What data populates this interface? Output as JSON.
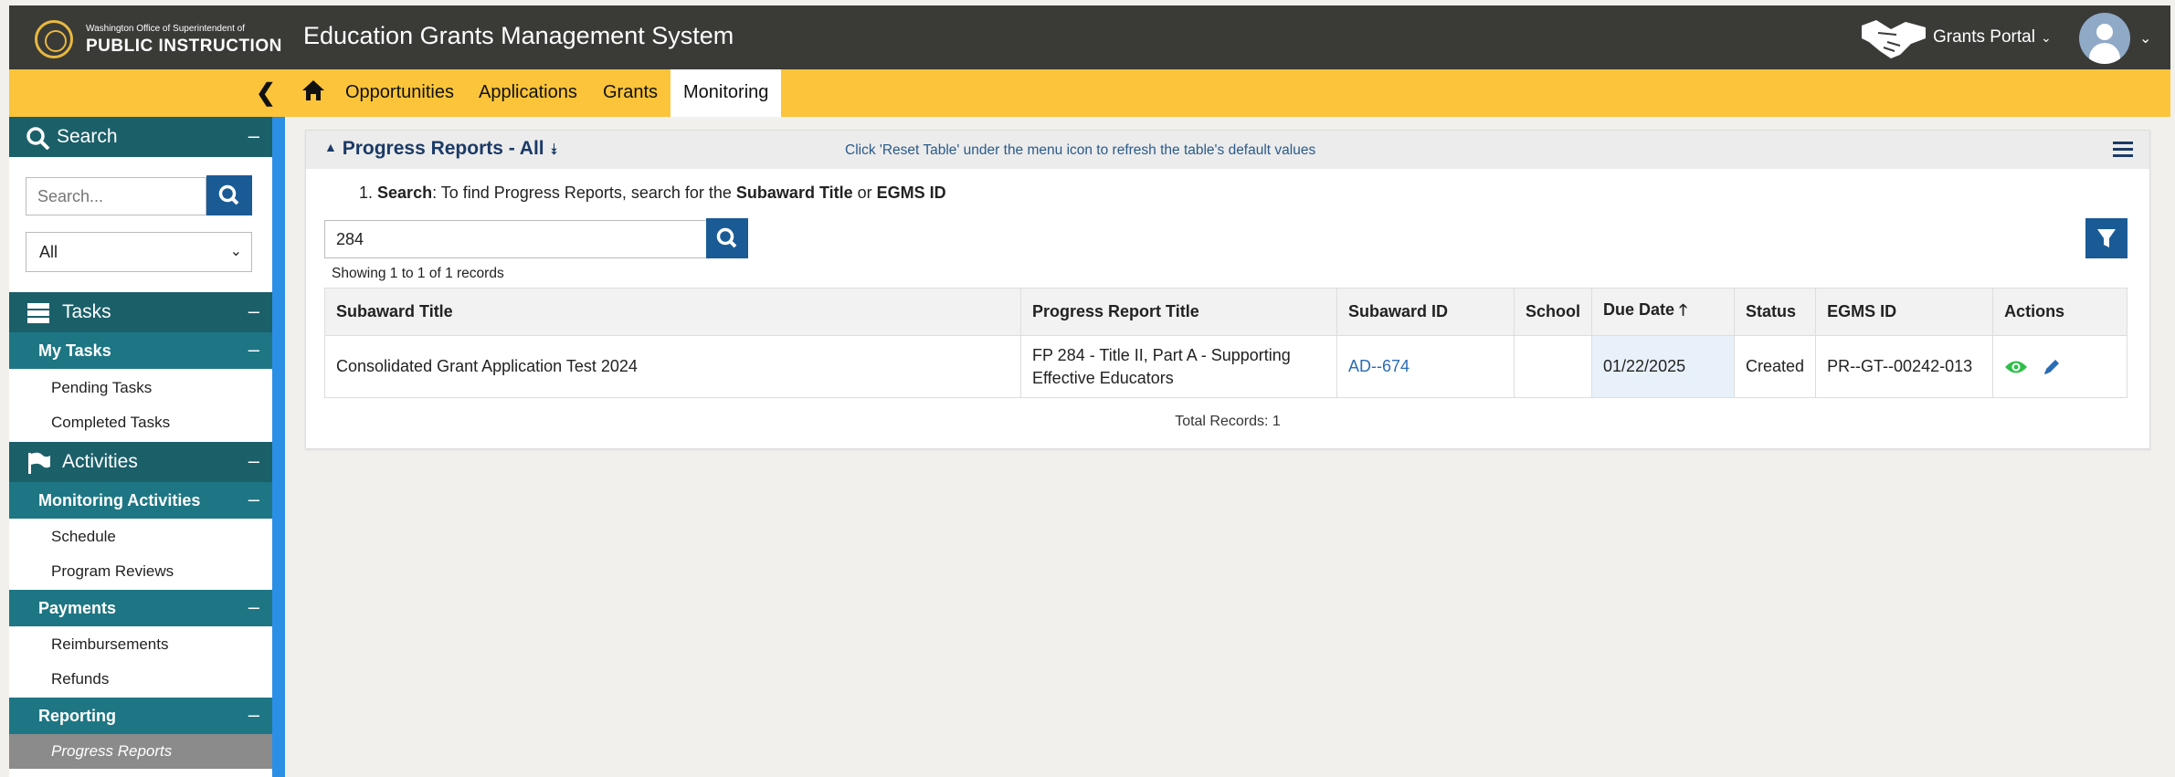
{
  "header": {
    "org_small": "Washington Office of Superintendent of",
    "org_big": "PUBLIC INSTRUCTION",
    "app_title": "Education Grants Management System",
    "portal_label": "Grants Portal",
    "colors": {
      "header_bg": "#3a3a37",
      "nav_bg": "#fbc43a",
      "sidebar_dark": "#1b5f69",
      "accent_blue": "#1a5b96"
    }
  },
  "nav": {
    "items": [
      "Opportunities",
      "Applications",
      "Grants",
      "Monitoring"
    ],
    "active": "Monitoring"
  },
  "sidebar": {
    "search_section": "Search",
    "search_placeholder": "Search...",
    "select_value": "All",
    "tasks_section": "Tasks",
    "my_tasks": "My Tasks",
    "pending_tasks": "Pending Tasks",
    "completed_tasks": "Completed Tasks",
    "activities_section": "Activities",
    "monitoring_activities": "Monitoring Activities",
    "schedule": "Schedule",
    "program_reviews": "Program Reviews",
    "payments": "Payments",
    "reimbursements": "Reimbursements",
    "refunds": "Refunds",
    "reporting": "Reporting",
    "progress_reports": "Progress Reports",
    "minus": "–"
  },
  "panel": {
    "title": "Progress Reports - All",
    "hint": "Click 'Reset Table' under the menu icon to refresh the table's default values",
    "instruction_prefix": "1.",
    "instruction_search": "Search",
    "instruction_mid": ": To find Progress Reports, search for the",
    "instruction_term1": "Subaward Title",
    "instruction_or": "or",
    "instruction_term2": "EGMS ID",
    "search_value": "284",
    "showing": "Showing 1 to 1 of 1 records",
    "total": "Total Records: 1"
  },
  "table": {
    "columns": [
      "Subaward Title",
      "Progress Report Title",
      "Subaward ID",
      "School",
      "Due Date",
      "Status",
      "EGMS ID",
      "Actions"
    ],
    "sort_indicator": "🡑",
    "rows": [
      {
        "subaward_title": "Consolidated Grant Application Test 2024",
        "report_title_line1": "FP 284 - Title II, Part A - Supporting",
        "report_title_line2": "Effective Educators",
        "subaward_id": "AD--674",
        "school": "",
        "due_date": "01/22/2025",
        "status": "Created",
        "egms_id": "PR--GT--00242-013"
      }
    ]
  }
}
